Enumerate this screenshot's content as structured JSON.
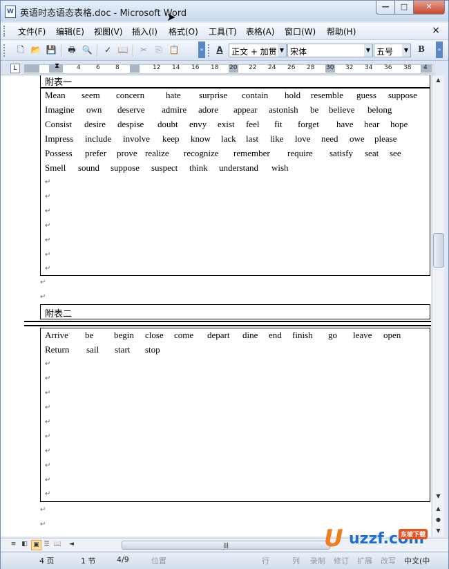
{
  "window": {
    "title": "英语时态语态表格.doc - Microsoft Word",
    "app_icon": "W"
  },
  "menubar": {
    "items": [
      "文件(F)",
      "编辑(E)",
      "视图(V)",
      "插入(I)",
      "格式(O)",
      "工具(T)",
      "表格(A)",
      "窗口(W)",
      "帮助(H)"
    ],
    "close": "×"
  },
  "toolbar": {
    "style_combo": "正文 + 加贯",
    "font_combo": "宋体",
    "size_combo": "五号",
    "bold": "B"
  },
  "ruler": {
    "numbers": [
      "4",
      "6",
      "8",
      "12",
      "14",
      "16",
      "18",
      "20",
      "22",
      "24",
      "26",
      "28",
      "30",
      "32",
      "34",
      "36",
      "38",
      "4"
    ],
    "tab_symbol": "L"
  },
  "document": {
    "table1_caption": "附表一",
    "table1_rows": [
      [
        "Mean",
        "seem",
        "concern",
        "hate",
        "surprise",
        "contain",
        "hold",
        "resemble",
        "guess",
        "suppose"
      ],
      [
        "Imagine",
        "own",
        "deserve",
        "admire",
        "adore",
        "appear",
        "astonish",
        "be",
        "believe",
        "belong"
      ],
      [
        "Consist",
        "desire",
        "despise",
        "doubt",
        "envy",
        "exist",
        "feel",
        "fit",
        "forget",
        "have",
        "hear",
        "hope"
      ],
      [
        "Impress",
        "include",
        "involve",
        "keep",
        "know",
        "lack",
        "last",
        "like",
        "love",
        "need",
        "owe",
        "please"
      ],
      [
        "Possess",
        "prefer",
        "prove",
        "realize",
        "recognize",
        "remember",
        "require",
        "satisfy",
        "seat",
        "see"
      ],
      [
        "Smell",
        "sound",
        "suppose",
        "suspect",
        "think",
        "understand",
        "wish"
      ]
    ],
    "table2_caption": "附表二",
    "table2_rows": [
      [
        "Arrive",
        "be",
        "begin",
        "close",
        "come",
        "depart",
        "dine",
        "end",
        "finish",
        "go",
        "leave",
        "open"
      ],
      [
        "Return",
        "sail",
        "start",
        "stop"
      ]
    ],
    "paragraph_mark": "↵"
  },
  "statusbar": {
    "page": "4 页",
    "section": "1 节",
    "page_of": "4/9",
    "position": "位置",
    "line": "行",
    "column": "列",
    "rec": "录制",
    "trk": "修订",
    "ext": "扩展",
    "ovr": "改写",
    "language": "中文(中"
  },
  "watermark": {
    "brand": "uzzf.com",
    "badge": "东坡下载"
  }
}
